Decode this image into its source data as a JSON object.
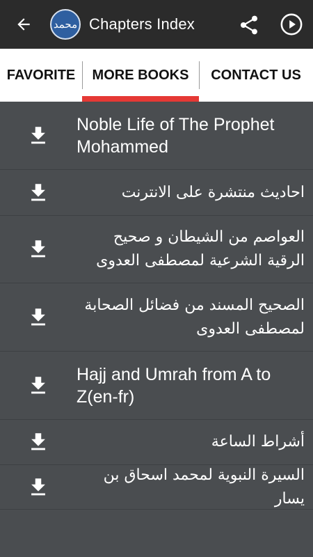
{
  "appbar": {
    "title": "Chapters Index",
    "logo_text": "محمد",
    "icons": [
      "back-arrow-icon",
      "share-icon",
      "play-icon"
    ]
  },
  "tabs": [
    {
      "label": "FAVORITE",
      "active": false
    },
    {
      "label": "MORE BOOKS",
      "active": true
    },
    {
      "label": "CONTACT US",
      "active": false
    }
  ],
  "books": [
    {
      "title": "Noble Life of The Prophet Mohammed",
      "lang": "en"
    },
    {
      "title": "احاديث منتشرة على الانترنت",
      "lang": "ar"
    },
    {
      "title": "العواصم من الشيطان و صحيح الرقية الشرعية لمصطفى العدوى",
      "lang": "ar"
    },
    {
      "title": "الصحيح المسند من فضائل الصحابة لمصطفى العدوى",
      "lang": "ar"
    },
    {
      "title": "Hajj and Umrah from A to Z(en-fr)",
      "lang": "en"
    },
    {
      "title": "أشراط الساعة",
      "lang": "ar"
    },
    {
      "title": "السيرة النبوية لمحمد اسحاق بن يسار",
      "lang": "ar"
    }
  ],
  "colors": {
    "appbar": "#2b2b2b",
    "tab_bar": "#ffffff",
    "tab_indicator": "#e53935",
    "list_bg": "#4a4d50"
  }
}
